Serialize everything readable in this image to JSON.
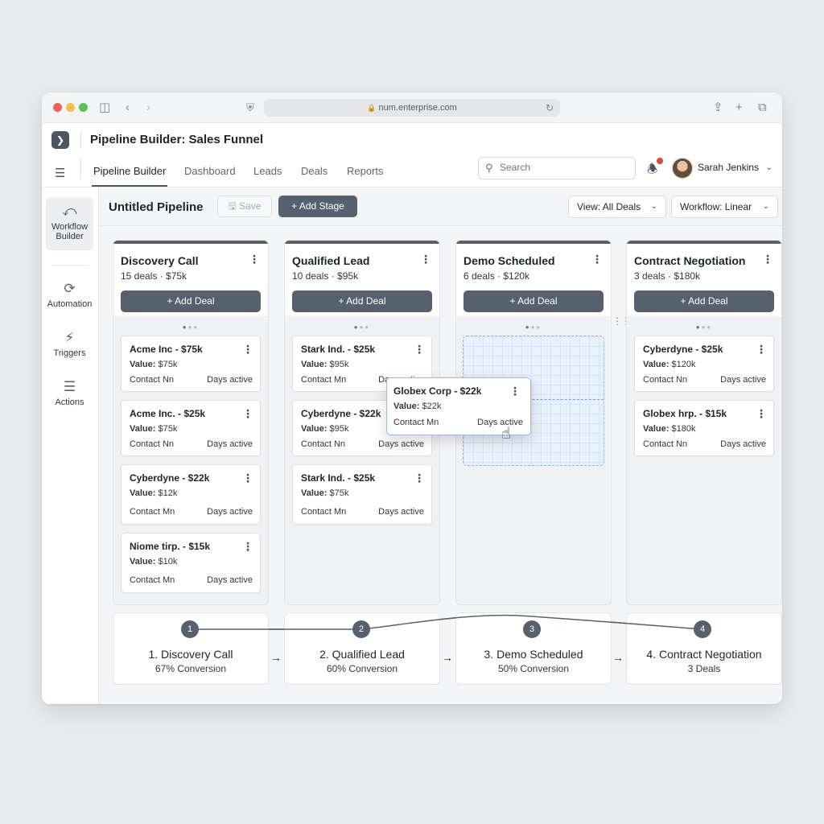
{
  "browser": {
    "url": "num.enterprise.com",
    "icons": [
      "sidebar-toggle-icon",
      "back-icon",
      "forward-icon",
      "shield-icon",
      "lock-icon",
      "reload-icon",
      "share-icon",
      "new-tab-icon",
      "tabs-icon"
    ]
  },
  "app": {
    "title": "Pipeline Builder: Sales Funnel",
    "nav": [
      "Pipeline Builder",
      "Dashboard",
      "Leads",
      "Deals",
      "Reports"
    ],
    "search_placeholder": "Search",
    "user": "Sarah Jenkins"
  },
  "sidebar": {
    "items": [
      {
        "label": "Workflow Builder",
        "icon": "workflow-icon"
      },
      {
        "label": "Automation",
        "icon": "automation-icon"
      },
      {
        "label": "Triggers",
        "icon": "lightning-icon"
      },
      {
        "label": "Actions",
        "icon": "list-icon"
      }
    ]
  },
  "toolbar": {
    "pipeline_name": "Untitled Pipeline",
    "save": "Save",
    "add_stage": "Add Stage",
    "view": "View: All Deals",
    "workflow": "Workflow: Linear"
  },
  "add_deal": "Add Deal",
  "columns": [
    {
      "title": "Discovery Call",
      "summary": "15 deals · $75k",
      "cards": [
        {
          "title": "Acme Inc - $75k",
          "value_label": "Value:",
          "value": "$75k",
          "contact": "Contact Nn",
          "days": "Days active"
        },
        {
          "title": "Acme Inc. - $25k",
          "value_label": "Value:",
          "value": "$75k",
          "contact": "Contact Nn",
          "days": "Days active"
        },
        {
          "title": "Cyberdyne - $22k",
          "value_label": "Value:",
          "value": "$12k",
          "contact": "Contact Mn",
          "days": "Days active"
        },
        {
          "title": "Niome tirp. - $15k",
          "value_label": "Value:",
          "value": "$10k",
          "contact": "Contact Mn",
          "days": "Days active"
        }
      ]
    },
    {
      "title": "Qualified Lead",
      "summary": "10 deals · $95k",
      "cards": [
        {
          "title": "Stark Ind. - $25k",
          "value_label": "Value:",
          "value": "$95k",
          "contact": "Contact Mn",
          "days": "Days active"
        },
        {
          "title": "Cyberdyne - $22k",
          "value_label": "Value:",
          "value": "$95k",
          "contact": "Contact Nn",
          "days": "Days active"
        },
        {
          "title": "Stark Ind. - $25k",
          "value_label": "Value:",
          "value": "$75k",
          "contact": "Contact Mn",
          "days": "Days active"
        }
      ]
    },
    {
      "title": "Demo Scheduled",
      "summary": "6 deals · $120k",
      "cards": []
    },
    {
      "title": "Contract Negotiation",
      "summary": "3 deals · $180k",
      "cards": [
        {
          "title": "Cyberdyne - $25k",
          "value_label": "Value:",
          "value": "$120k",
          "contact": "Contact Nn",
          "days": "Days active"
        },
        {
          "title": "Globex hrp. - $15k",
          "value_label": "Value:",
          "value": "$180k",
          "contact": "Contact Nn",
          "days": "Days active"
        }
      ]
    }
  ],
  "dragging_card": {
    "title": "Globex Corp - $22k",
    "value_label": "Value:",
    "value": "$22k",
    "contact": "Contact Mn",
    "days": "Days active"
  },
  "flow": [
    {
      "num": "1",
      "title": "1. Discovery Call",
      "sub": "67% Conversion"
    },
    {
      "num": "2",
      "title": "2. Qualified Lead",
      "sub": "60% Conversion"
    },
    {
      "num": "3",
      "title": "3. Demo Scheduled",
      "sub": "50% Conversion"
    },
    {
      "num": "4",
      "title": "4. Contract Negotiation",
      "sub": "3 Deals"
    }
  ],
  "colors": {
    "accent": "#566170",
    "dropzone": "#8fb4de",
    "notification": "#e2463d"
  }
}
